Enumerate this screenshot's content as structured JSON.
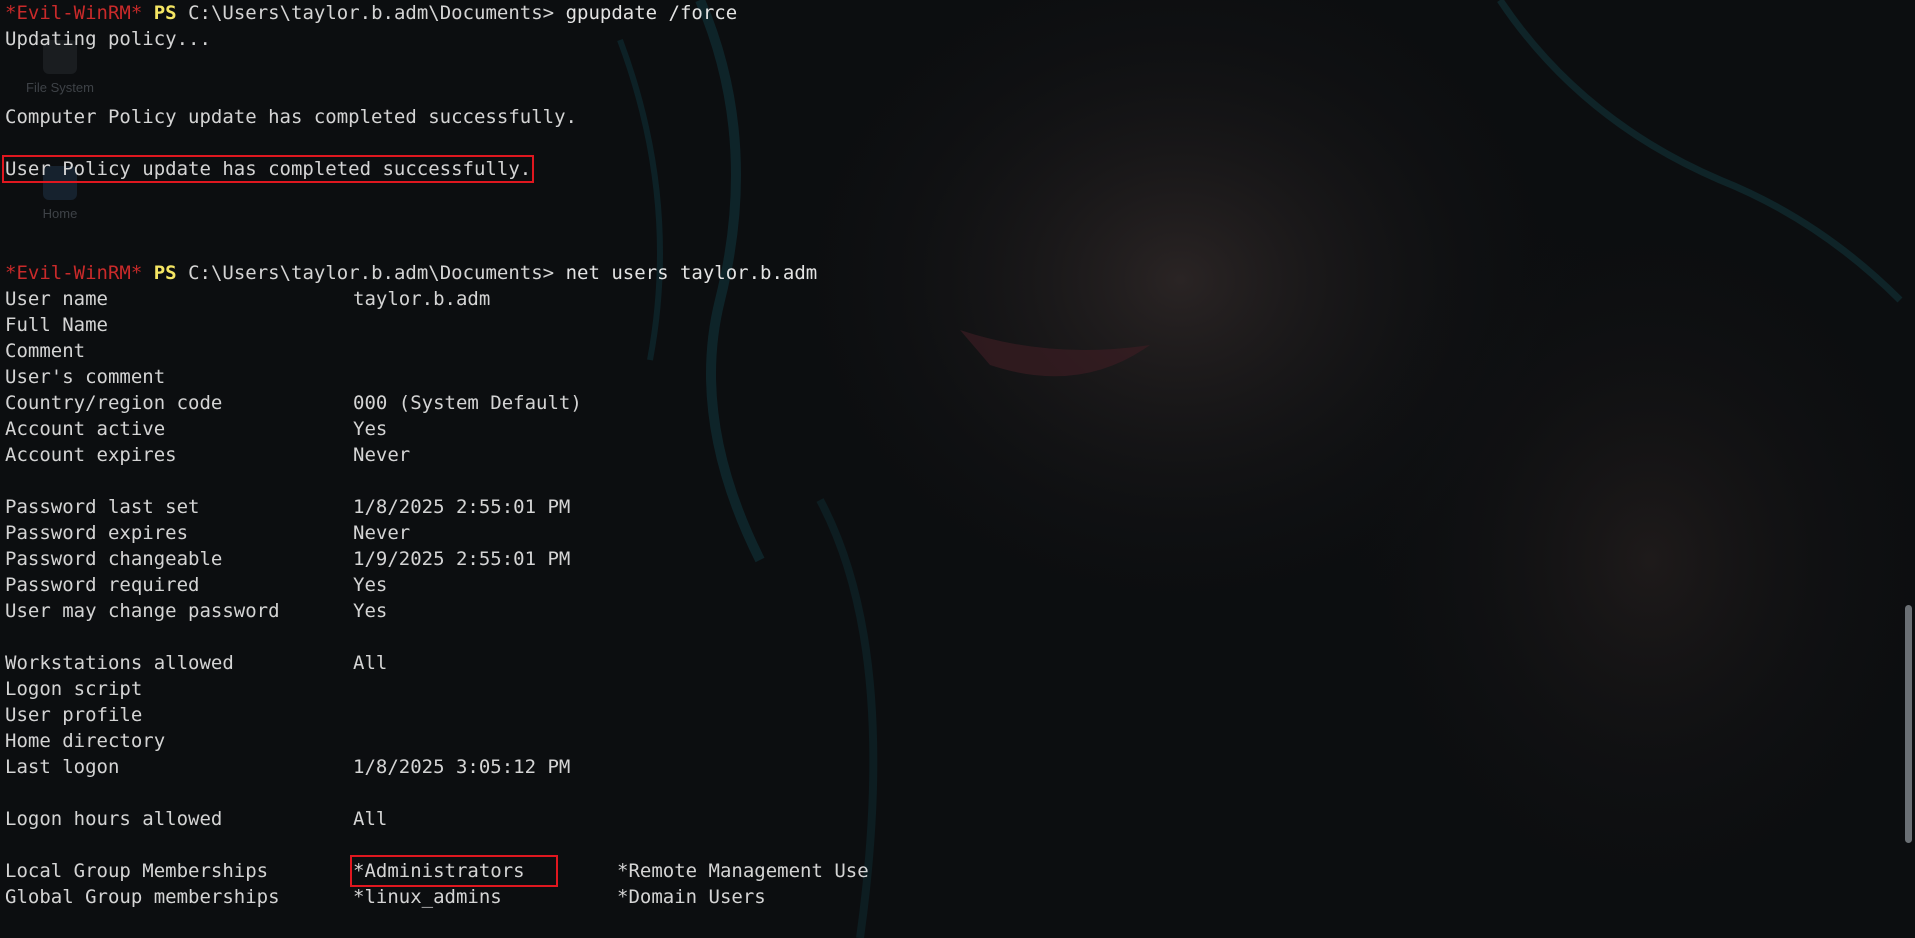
{
  "desktop": {
    "icons": [
      {
        "label": "File System",
        "icon": "drive-icon"
      },
      {
        "label": "Home",
        "icon": "home-folder-icon"
      }
    ]
  },
  "prompt": {
    "tag": "*Evil-WinRM*",
    "ps": "PS",
    "path": "C:\\Users\\taylor.b.adm\\Documents>"
  },
  "commands": {
    "first": "gpupdate /force",
    "second": "net users taylor.b.adm"
  },
  "gpupdate_output": {
    "updating": "Updating policy...",
    "computer_policy": "Computer Policy update has completed successfully.",
    "user_policy": "User Policy update has completed successfully."
  },
  "user_info": [
    {
      "label": "User name",
      "value": "taylor.b.adm"
    },
    {
      "label": "Full Name",
      "value": ""
    },
    {
      "label": "Comment",
      "value": ""
    },
    {
      "label": "User's comment",
      "value": ""
    },
    {
      "label": "Country/region code",
      "value": "000 (System Default)"
    },
    {
      "label": "Account active",
      "value": "Yes"
    },
    {
      "label": "Account expires",
      "value": "Never"
    },
    {
      "label": "Password last set",
      "value": "1/8/2025 2:55:01 PM"
    },
    {
      "label": "Password expires",
      "value": "Never"
    },
    {
      "label": "Password changeable",
      "value": "1/9/2025 2:55:01 PM"
    },
    {
      "label": "Password required",
      "value": "Yes"
    },
    {
      "label": "User may change password",
      "value": "Yes"
    },
    {
      "label": "Workstations allowed",
      "value": "All"
    },
    {
      "label": "Logon script",
      "value": ""
    },
    {
      "label": "User profile",
      "value": ""
    },
    {
      "label": "Home directory",
      "value": ""
    },
    {
      "label": "Last logon",
      "value": "1/8/2025 3:05:12 PM"
    },
    {
      "label": "Logon hours allowed",
      "value": "All"
    }
  ],
  "groups": {
    "local": {
      "label": "Local Group Memberships",
      "first": "*Administrators",
      "second": "*Remote Management Use"
    },
    "global": {
      "label": "Global Group memberships",
      "first": "*linux_admins",
      "second": "*Domain Users"
    }
  },
  "colors": {
    "prompt_tag": "#c92a2a",
    "prompt_ps": "#f5e663",
    "highlight_box": "#e0171f",
    "background": "#0c0e10"
  }
}
